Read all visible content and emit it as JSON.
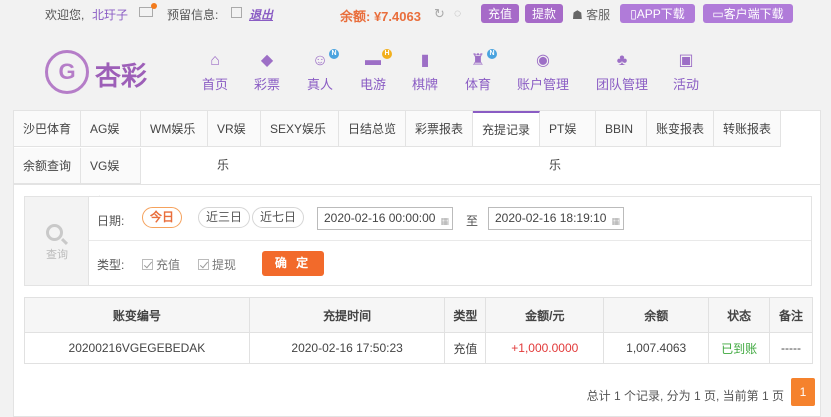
{
  "topbar": {
    "welcome": "欢迎您,",
    "username": "北玗子",
    "notice_label": "预留信息:",
    "logout": "退出",
    "balance": "余额: ¥7.4063",
    "recharge": "充值",
    "withdraw": "提款",
    "service": "客服",
    "app_download": "APP下载",
    "client_download": "客户端下载"
  },
  "logo": {
    "mark": "G",
    "text": "杏彩"
  },
  "nav": [
    {
      "label": "首页",
      "icon": "home-icon",
      "glyph": "⌂",
      "badge": ""
    },
    {
      "label": "彩票",
      "icon": "lottery-icon",
      "glyph": "◆",
      "badge": ""
    },
    {
      "label": "真人",
      "icon": "live-dealer-icon",
      "glyph": "☺",
      "badge": "N"
    },
    {
      "label": "电游",
      "icon": "gamepad-icon",
      "glyph": "▬",
      "badge": "H"
    },
    {
      "label": "棋牌",
      "icon": "cards-icon",
      "glyph": "▮",
      "badge": ""
    },
    {
      "label": "体育",
      "icon": "trophy-icon",
      "glyph": "♜",
      "badge": "N"
    },
    {
      "label": "账户管理",
      "icon": "account-icon",
      "glyph": "◉",
      "badge": ""
    },
    {
      "label": "团队管理",
      "icon": "team-icon",
      "glyph": "♣",
      "badge": ""
    },
    {
      "label": "活动",
      "icon": "gift-icon",
      "glyph": "▣",
      "badge": ""
    }
  ],
  "tabs": [
    {
      "label": "沙巴体育"
    },
    {
      "label": "AG娱乐"
    },
    {
      "label": "WM娱乐"
    },
    {
      "label": "VR娱乐"
    },
    {
      "label": "SEXY娱乐"
    },
    {
      "label": "日结总览"
    },
    {
      "label": "彩票报表"
    },
    {
      "label": "充提记录"
    },
    {
      "label": "PT娱乐"
    },
    {
      "label": "BBIN"
    },
    {
      "label": "账变报表"
    },
    {
      "label": "转账报表"
    },
    {
      "label": "余额查询"
    },
    {
      "label": "VG娱乐"
    }
  ],
  "active_tab": "充提记录",
  "filter": {
    "query_label": "查询",
    "date_label": "日期:",
    "quick_dates": [
      "今日",
      "近三日",
      "近七日"
    ],
    "start": "2020-02-16 00:00:00",
    "to": "至",
    "end": "2020-02-16 18:19:10",
    "type_label": "类型:",
    "type_recharge": "充值",
    "type_withdraw": "提现",
    "confirm": "确 定"
  },
  "table": {
    "headers": [
      "账变编号",
      "充提时间",
      "类型",
      "金额/元",
      "余额",
      "状态",
      "备注"
    ],
    "rows": [
      [
        "20200216VGEGEBEDAK",
        "2020-02-16 17:50:23",
        "充值",
        "+1,000.0000",
        "1,007.4063",
        "已到账",
        "-----"
      ]
    ]
  },
  "pager": {
    "summary": "总计 1 个记录, 分为 1 页, 当前第 1 页",
    "current": "1"
  },
  "colors": {
    "accent": "#8a5cc4",
    "orange": "#f26a2b",
    "green": "#3ea83e",
    "red": "#e23a3a"
  }
}
